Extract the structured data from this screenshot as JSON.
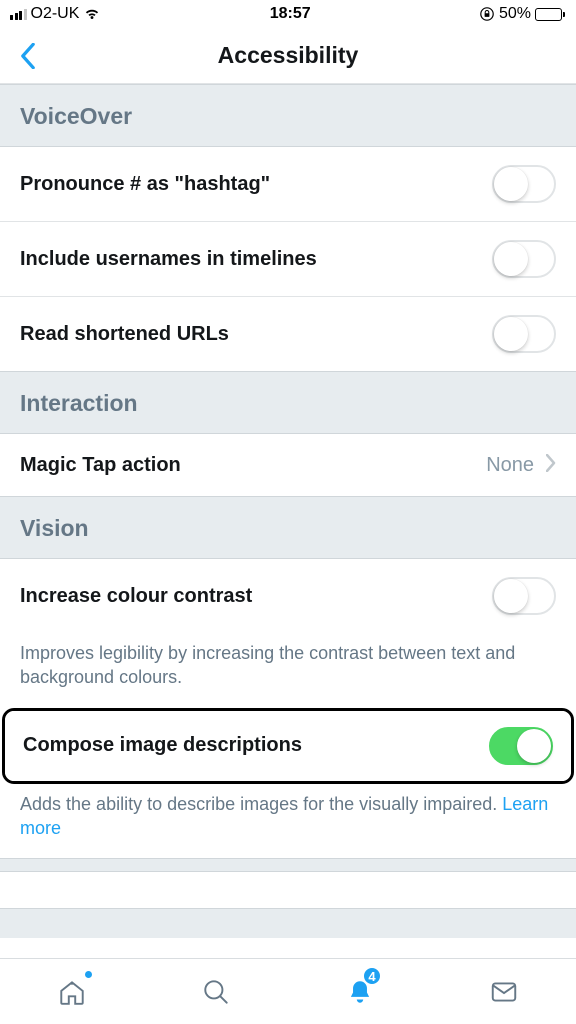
{
  "statusBar": {
    "carrier": "O2-UK",
    "time": "18:57",
    "batteryPercent": "50%"
  },
  "nav": {
    "title": "Accessibility"
  },
  "sections": {
    "voiceOver": {
      "header": "VoiceOver",
      "items": [
        {
          "label": "Pronounce # as \"hashtag\""
        },
        {
          "label": "Include usernames in timelines"
        },
        {
          "label": "Read shortened URLs"
        }
      ]
    },
    "interaction": {
      "header": "Interaction",
      "magicTap": {
        "label": "Magic Tap action",
        "value": "None"
      }
    },
    "vision": {
      "header": "Vision",
      "contrast": {
        "label": "Increase colour contrast",
        "desc": "Improves legibility by increasing the contrast between text and background colours."
      },
      "compose": {
        "label": "Compose image descriptions",
        "desc": "Adds the ability to describe images for the visually impaired. ",
        "learnMore": "Learn more"
      }
    }
  },
  "tabBar": {
    "notificationsBadge": "4"
  }
}
